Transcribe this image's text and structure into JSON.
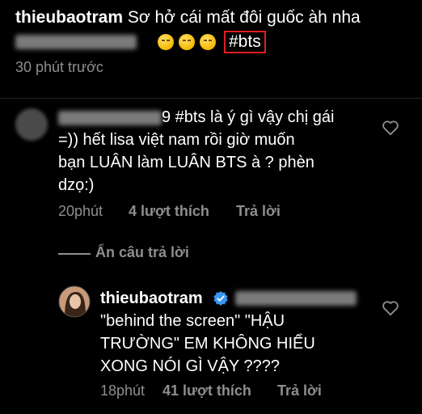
{
  "caption": {
    "username": "thieubaotram",
    "text": "Sơ hở cái mất đôi guốc àh nha",
    "hashtag": "#bts",
    "time": "30 phút trước"
  },
  "comment1": {
    "text_line1": "9 #bts là ý gì vậy chị gái",
    "text_line2": "=)) hết lisa việt nam rồi giờ muốn",
    "text_line3": "bạn LUÂN làm LUÂN BTS à ? phèn",
    "text_line4": "dzọ:)",
    "time": "20phút",
    "likes": "4 lượt thích",
    "reply": "Trả lời"
  },
  "hide_replies": "Ẩn câu trả lời",
  "reply1": {
    "username": "thieubaotram",
    "text_line1": "\"behind the screen\" \"HẬU",
    "text_line2": "TRƯỜNG\" EM KHÔNG HIỂU",
    "text_line3": "XONG NÓI GÌ VẬY ????",
    "time": "18phút",
    "likes": "41 lượt thích",
    "reply": "Trả lời"
  },
  "colors": {
    "background": "#000000",
    "meta": "#8e8e8e",
    "highlight_box": "#e01e1e",
    "verified": "#3897f0"
  }
}
